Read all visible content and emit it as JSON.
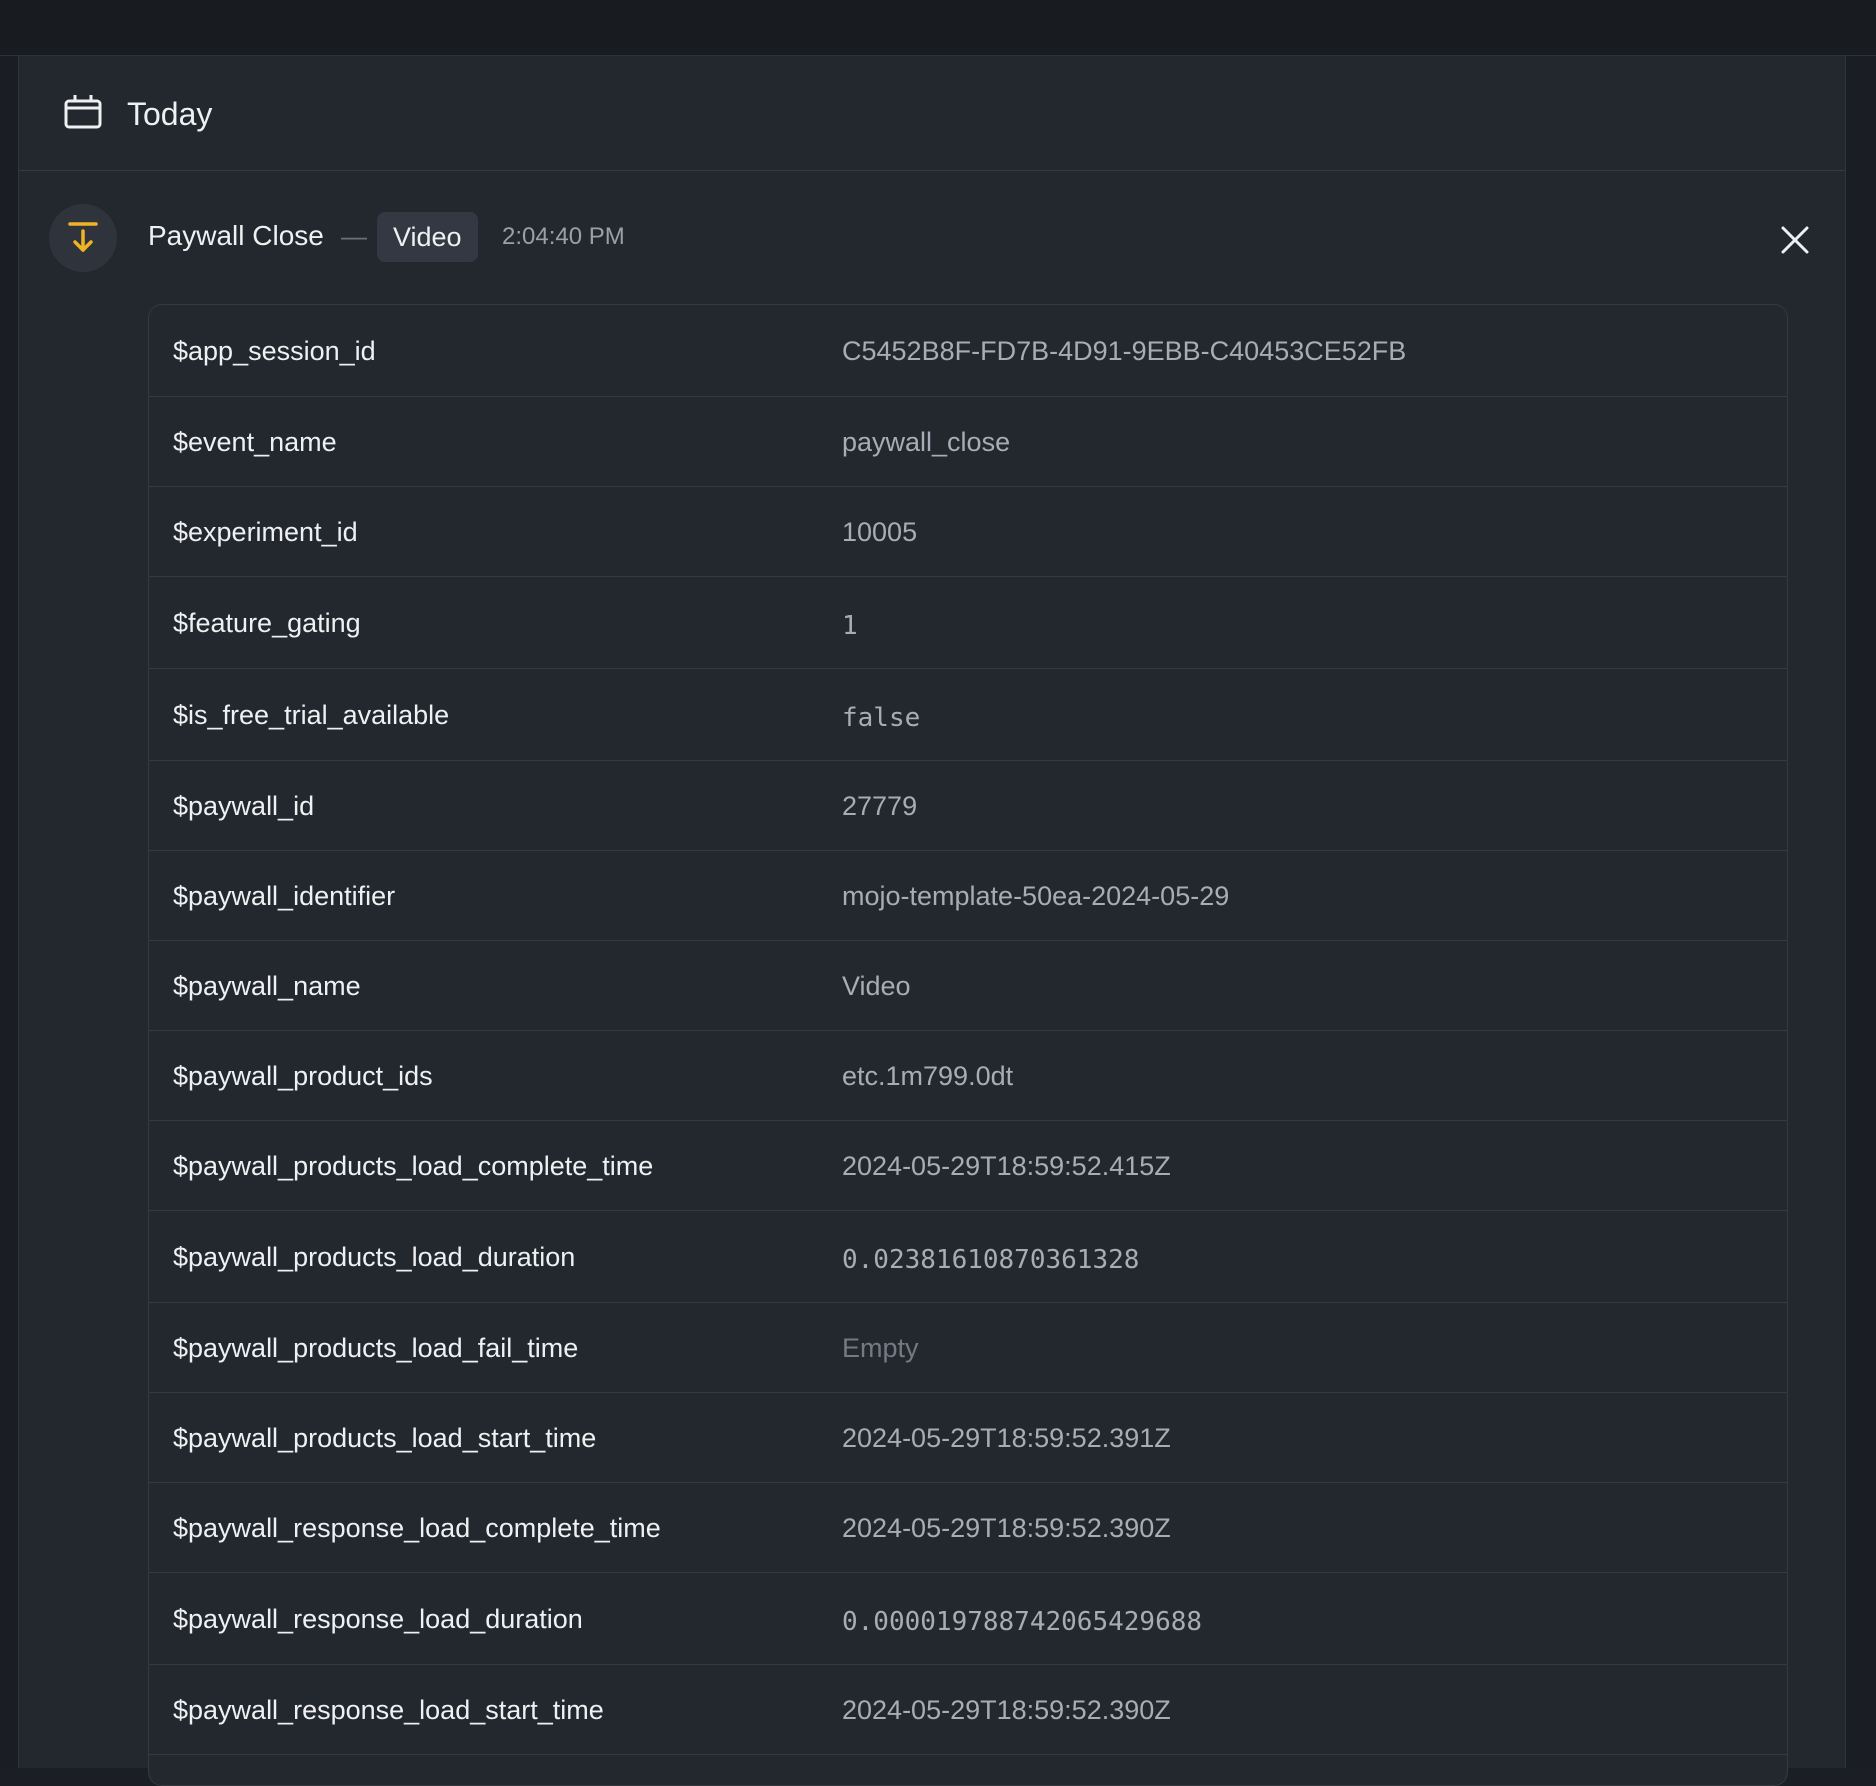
{
  "day_header": {
    "title": "Today",
    "icon": "calendar-icon"
  },
  "event": {
    "name": "Paywall Close",
    "separator": "—",
    "badge": "Video",
    "time": "2:04:40 PM",
    "icon": "arrow-down-to-line-icon",
    "icon_color": "#f0b323"
  },
  "properties": [
    {
      "key": "$app_session_id",
      "value": "C5452B8F-FD7B-4D91-9EBB-C40453CE52FB",
      "style": "text"
    },
    {
      "key": "$event_name",
      "value": "paywall_close",
      "style": "text"
    },
    {
      "key": "$experiment_id",
      "value": "10005",
      "style": "text"
    },
    {
      "key": "$feature_gating",
      "value": "1",
      "style": "mono"
    },
    {
      "key": "$is_free_trial_available",
      "value": "false",
      "style": "mono"
    },
    {
      "key": "$paywall_id",
      "value": "27779",
      "style": "text"
    },
    {
      "key": "$paywall_identifier",
      "value": "mojo-template-50ea-2024-05-29",
      "style": "text"
    },
    {
      "key": "$paywall_name",
      "value": "Video",
      "style": "text"
    },
    {
      "key": "$paywall_product_ids",
      "value": "etc.1m799.0dt",
      "style": "text"
    },
    {
      "key": "$paywall_products_load_complete_time",
      "value": "2024-05-29T18:59:52.415Z",
      "style": "text"
    },
    {
      "key": "$paywall_products_load_duration",
      "value": "0.02381610870361328",
      "style": "mono"
    },
    {
      "key": "$paywall_products_load_fail_time",
      "value": "Empty",
      "style": "empty"
    },
    {
      "key": "$paywall_products_load_start_time",
      "value": "2024-05-29T18:59:52.391Z",
      "style": "text"
    },
    {
      "key": "$paywall_response_load_complete_time",
      "value": "2024-05-29T18:59:52.390Z",
      "style": "text"
    },
    {
      "key": "$paywall_response_load_duration",
      "value": "0.000019788742065429688",
      "style": "mono"
    },
    {
      "key": "$paywall_response_load_start_time",
      "value": "2024-05-29T18:59:52.390Z",
      "style": "text"
    }
  ]
}
